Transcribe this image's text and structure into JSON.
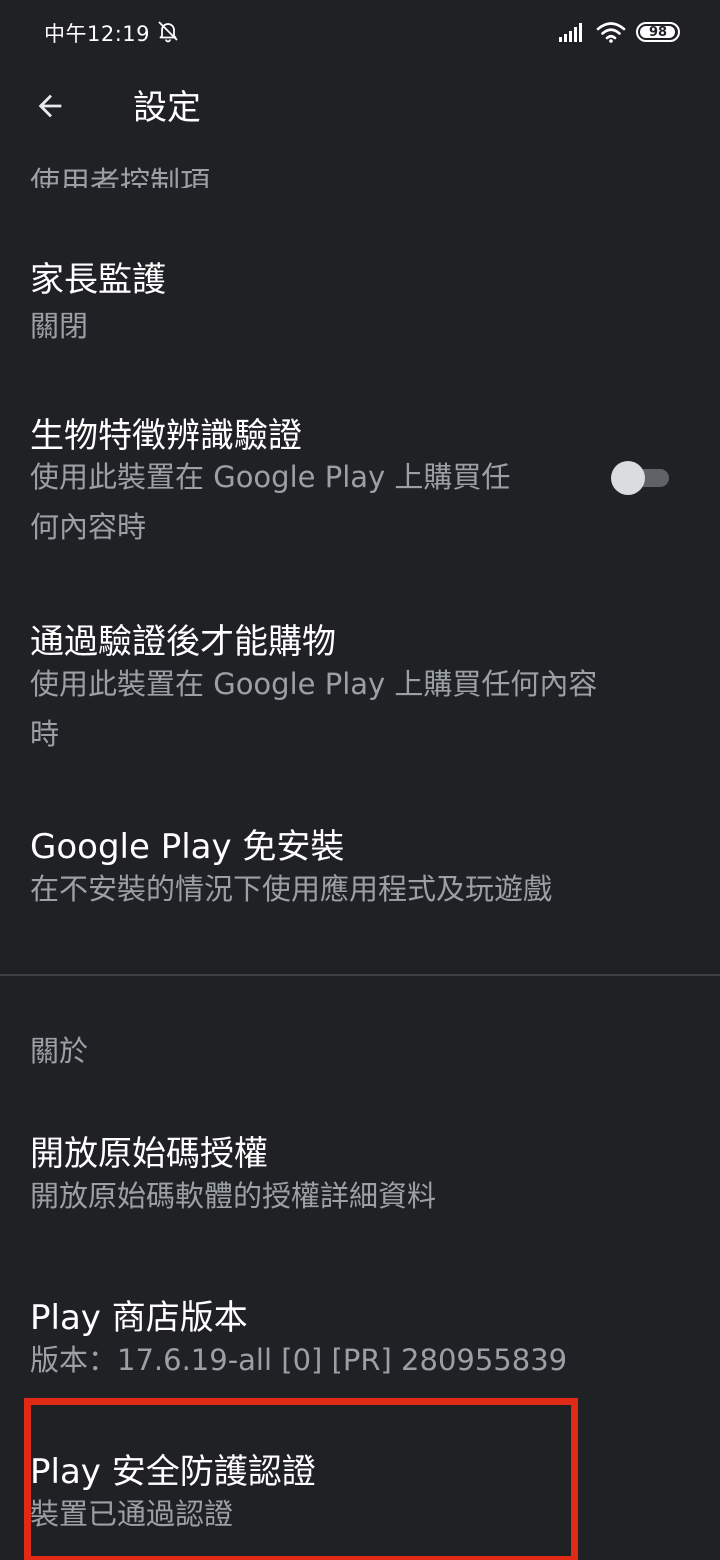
{
  "status_bar": {
    "time": "中午12:19",
    "battery_level": "98",
    "battery_fraction": 0.98
  },
  "app_bar": {
    "title": "設定"
  },
  "settings": {
    "partial_item_label": "使用者控制項",
    "parental_controls": {
      "title": "家長監護",
      "subtitle": "關閉"
    },
    "biometric": {
      "title": "生物特徵辨識驗證",
      "subtitle_line1": "使用此裝置在 Google Play 上購買任",
      "subtitle_line2": "何內容時",
      "toggle_on": false
    },
    "auth_purchase": {
      "title": "通過驗證後才能購物",
      "subtitle_line1": "使用此裝置在 Google Play 上購買任何內容",
      "subtitle_line2": "時"
    },
    "instant": {
      "title": "Google Play 免安裝",
      "subtitle": "在不安裝的情況下使用應用程式及玩遊戲"
    }
  },
  "about": {
    "header": "關於",
    "open_source": {
      "title": "開放原始碼授權",
      "subtitle": "開放原始碼軟體的授權詳細資料"
    },
    "store_version": {
      "title": "Play 商店版本",
      "subtitle": "版本：17.6.19-all [0] [PR] 280955839"
    },
    "protect_cert": {
      "title": "Play 安全防護認證",
      "subtitle": "裝置已通過認證"
    }
  },
  "colors": {
    "background": "#202124",
    "text_primary": "#ffffff",
    "text_secondary": "#9aa0a6",
    "highlight": "#e02a15"
  }
}
